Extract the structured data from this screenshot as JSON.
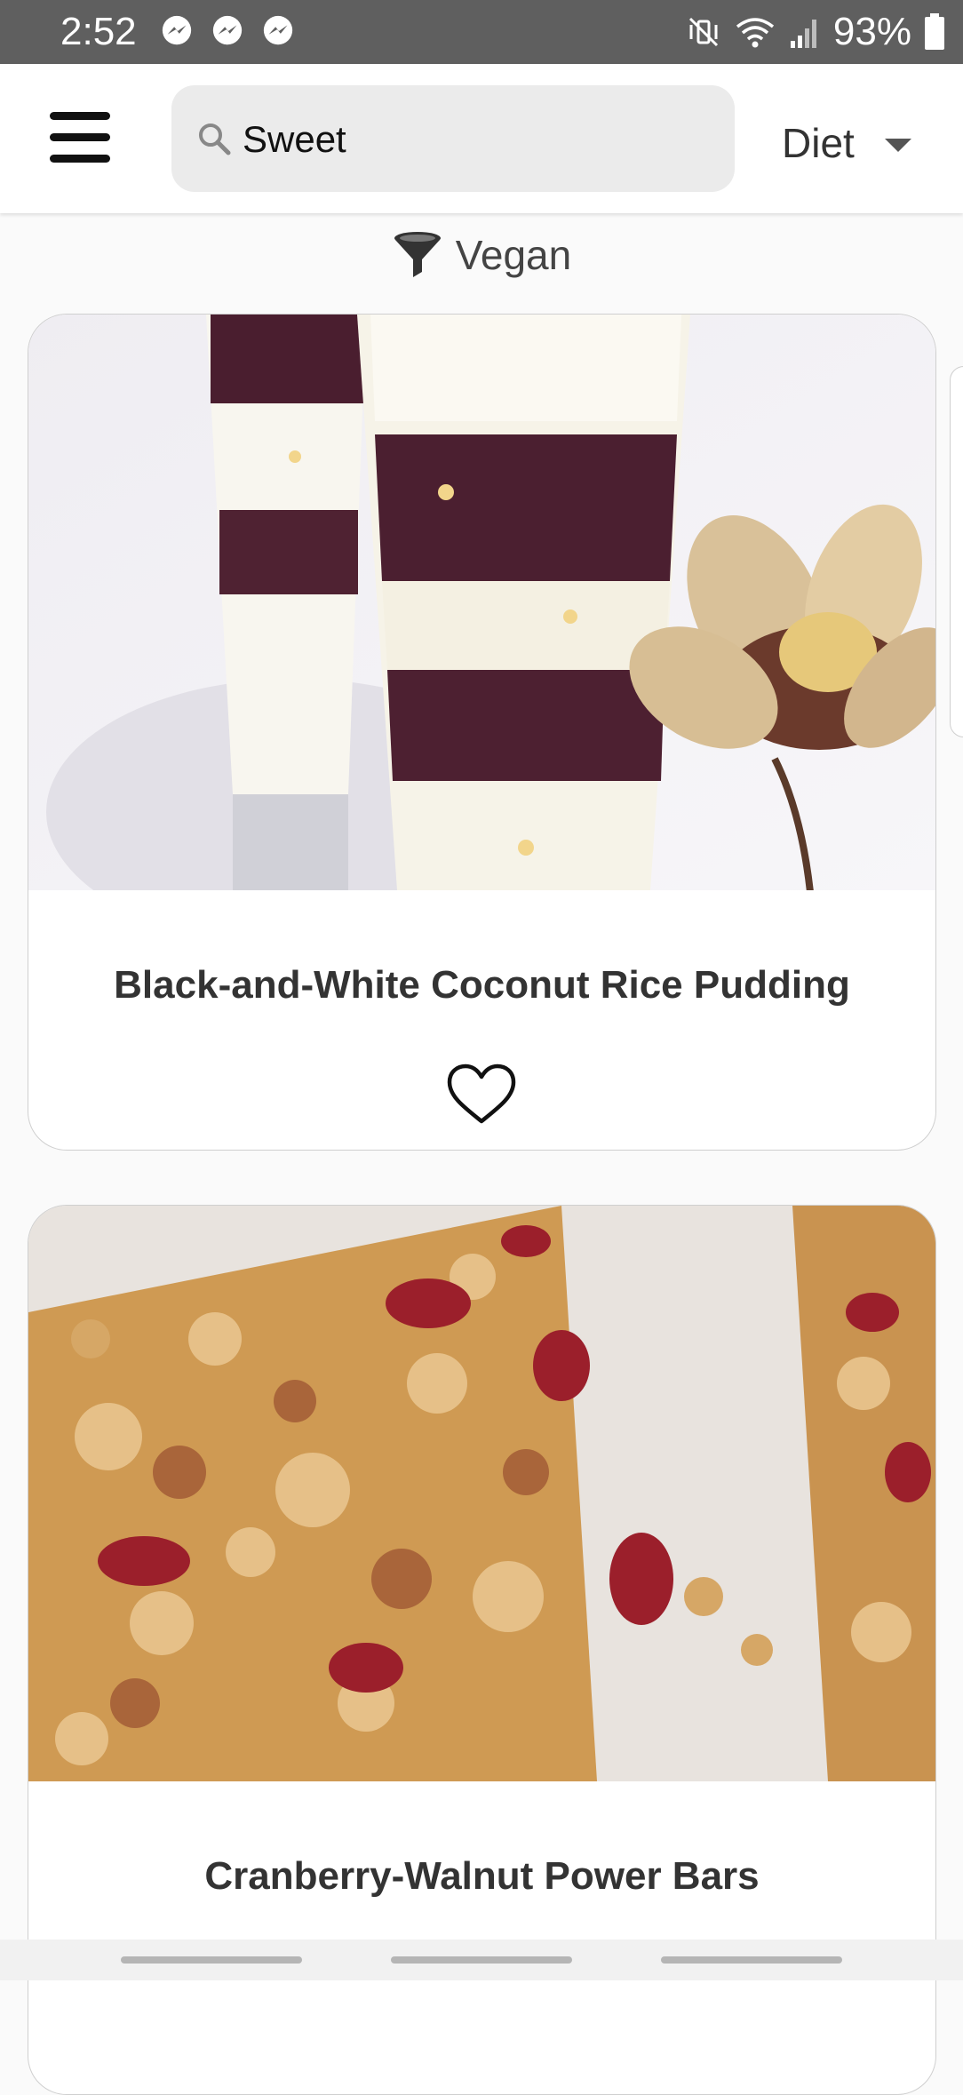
{
  "status_bar": {
    "time": "2:52",
    "notification_icons": [
      "messenger-icon",
      "messenger-icon",
      "messenger-icon"
    ],
    "system_icons": [
      "mute-vibrate-icon",
      "wifi-icon",
      "signal-icon",
      "battery-icon"
    ],
    "battery": "93%"
  },
  "app_bar": {
    "menu_icon": "hamburger-menu-icon",
    "search": {
      "value": "Sweet",
      "icon": "search-icon"
    },
    "diet_dropdown": {
      "label": "Diet",
      "icon": "caret-down-icon"
    }
  },
  "filter": {
    "icon": "filter-funnel-icon",
    "label": "Vegan"
  },
  "recipes": [
    {
      "title": "Black-and-White Coconut Rice Pudding",
      "image": "layered-rice-pudding-parfait-photo",
      "favorite_icon": "heart-outline-icon",
      "favorited": false
    },
    {
      "title": "Cranberry-Walnut Power Bars",
      "image": "granola-bars-photo"
    }
  ],
  "colors": {
    "status_bar": "#5f5f5f",
    "app_bar": "#ffffff",
    "search_bg": "#ebebeb",
    "page_bg": "#fafafa",
    "title_text": "#333333"
  }
}
